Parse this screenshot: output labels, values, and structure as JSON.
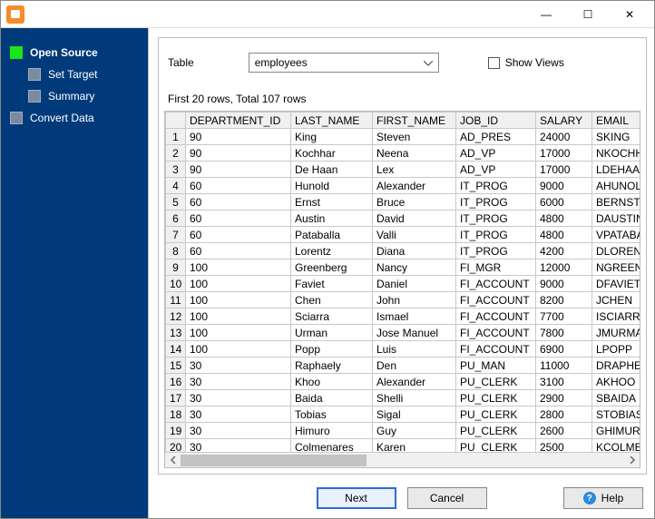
{
  "titlebar": {
    "min_glyph": "—",
    "max_glyph": "☐",
    "close_glyph": "✕"
  },
  "sidebar": {
    "items": [
      {
        "label": "Open Source",
        "state": "active"
      },
      {
        "label": "Set Target",
        "state": "child"
      },
      {
        "label": "Summary",
        "state": "child"
      },
      {
        "label": "Convert Data",
        "state": ""
      }
    ]
  },
  "toprow": {
    "table_label": "Table",
    "table_value": "employees",
    "show_views_label": "Show Views"
  },
  "info_line": "First 20 rows, Total 107 rows",
  "columns": [
    "DEPARTMENT_ID",
    "LAST_NAME",
    "FIRST_NAME",
    "JOB_ID",
    "SALARY",
    "EMAIL"
  ],
  "rows": [
    [
      "90",
      "King",
      "Steven",
      "AD_PRES",
      "24000",
      "SKING"
    ],
    [
      "90",
      "Kochhar",
      "Neena",
      "AD_VP",
      "17000",
      "NKOCHHAR"
    ],
    [
      "90",
      "De Haan",
      "Lex",
      "AD_VP",
      "17000",
      "LDEHAAN"
    ],
    [
      "60",
      "Hunold",
      "Alexander",
      "IT_PROG",
      "9000",
      "AHUNOLD"
    ],
    [
      "60",
      "Ernst",
      "Bruce",
      "IT_PROG",
      "6000",
      "BERNST"
    ],
    [
      "60",
      "Austin",
      "David",
      "IT_PROG",
      "4800",
      "DAUSTIN"
    ],
    [
      "60",
      "Pataballa",
      "Valli",
      "IT_PROG",
      "4800",
      "VPATABAL"
    ],
    [
      "60",
      "Lorentz",
      "Diana",
      "IT_PROG",
      "4200",
      "DLORENTZ"
    ],
    [
      "100",
      "Greenberg",
      "Nancy",
      "FI_MGR",
      "12000",
      "NGREENBE"
    ],
    [
      "100",
      "Faviet",
      "Daniel",
      "FI_ACCOUNT",
      "9000",
      "DFAVIET"
    ],
    [
      "100",
      "Chen",
      "John",
      "FI_ACCOUNT",
      "8200",
      "JCHEN"
    ],
    [
      "100",
      "Sciarra",
      "Ismael",
      "FI_ACCOUNT",
      "7700",
      "ISCIARRA"
    ],
    [
      "100",
      "Urman",
      "Jose Manuel",
      "FI_ACCOUNT",
      "7800",
      "JMURMAN"
    ],
    [
      "100",
      "Popp",
      "Luis",
      "FI_ACCOUNT",
      "6900",
      "LPOPP"
    ],
    [
      "30",
      "Raphaely",
      "Den",
      "PU_MAN",
      "11000",
      "DRAPHEAL"
    ],
    [
      "30",
      "Khoo",
      "Alexander",
      "PU_CLERK",
      "3100",
      "AKHOO"
    ],
    [
      "30",
      "Baida",
      "Shelli",
      "PU_CLERK",
      "2900",
      "SBAIDA"
    ],
    [
      "30",
      "Tobias",
      "Sigal",
      "PU_CLERK",
      "2800",
      "STOBIAS"
    ],
    [
      "30",
      "Himuro",
      "Guy",
      "PU_CLERK",
      "2600",
      "GHIMURO"
    ],
    [
      "30",
      "Colmenares",
      "Karen",
      "PU_CLERK",
      "2500",
      "KCOLMENA"
    ]
  ],
  "buttons": {
    "next": "Next",
    "cancel": "Cancel",
    "help": "Help"
  }
}
